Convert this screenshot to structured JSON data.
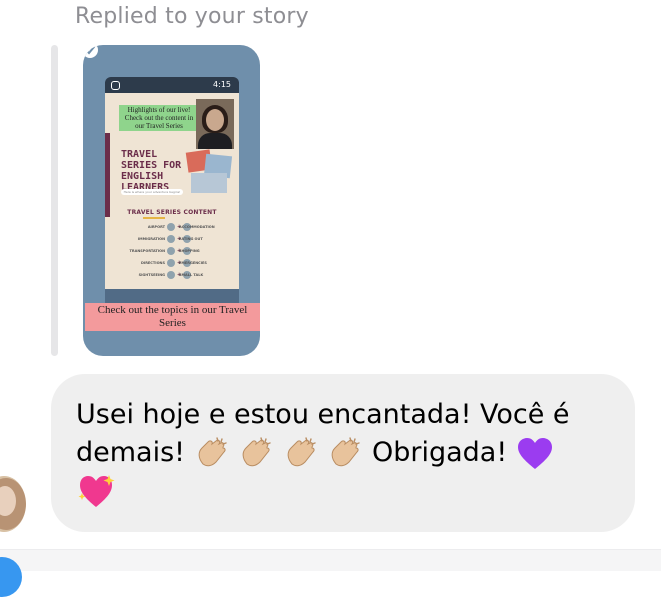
{
  "reply_header": "Replied to your story",
  "story": {
    "time": "4:15",
    "highlight_sticker": "Highlights of our live! Check out the content in our Travel Series",
    "poster_title": "TRAVEL SERIES FOR ENGLISH LEARNERS",
    "poster_subtitle": "Here is where your adventure begins!",
    "content_heading": "TRAVEL SERIES CONTENT",
    "topics": [
      {
        "left": "AIRPORT",
        "left_num": "01",
        "right_num": "06",
        "right": "ACCOMMODATION"
      },
      {
        "left": "IMMIGRATION",
        "left_num": "02",
        "right_num": "07",
        "right": "EATING OUT"
      },
      {
        "left": "TRANSPORTATION",
        "left_num": "03",
        "right_num": "08",
        "right": "SHOPPING"
      },
      {
        "left": "DIRECTIONS",
        "left_num": "04",
        "right_num": "09",
        "right": "EMERGENCIES"
      },
      {
        "left": "SIGHTSEEING",
        "left_num": "05",
        "right_num": "10",
        "right": "SMALL TALK"
      }
    ],
    "topics_sticker": "Check out the topics in our Travel Series"
  },
  "message": {
    "line1": "Usei hoje e estou encantada! Você é",
    "line2_start": "demais!",
    "line2_end": "Obrigada!",
    "emojis": [
      "clapping-hands-light-skin",
      "clapping-hands-light-skin",
      "clapping-hands-light-skin",
      "clapping-hands-light-skin",
      "purple-heart",
      "sparkling-heart"
    ]
  },
  "colors": {
    "bubble_bg": "#efefef",
    "story_card_bg": "#6f8fab",
    "reply_text": "#8e8e93",
    "accent_blue": "#3797f0"
  }
}
